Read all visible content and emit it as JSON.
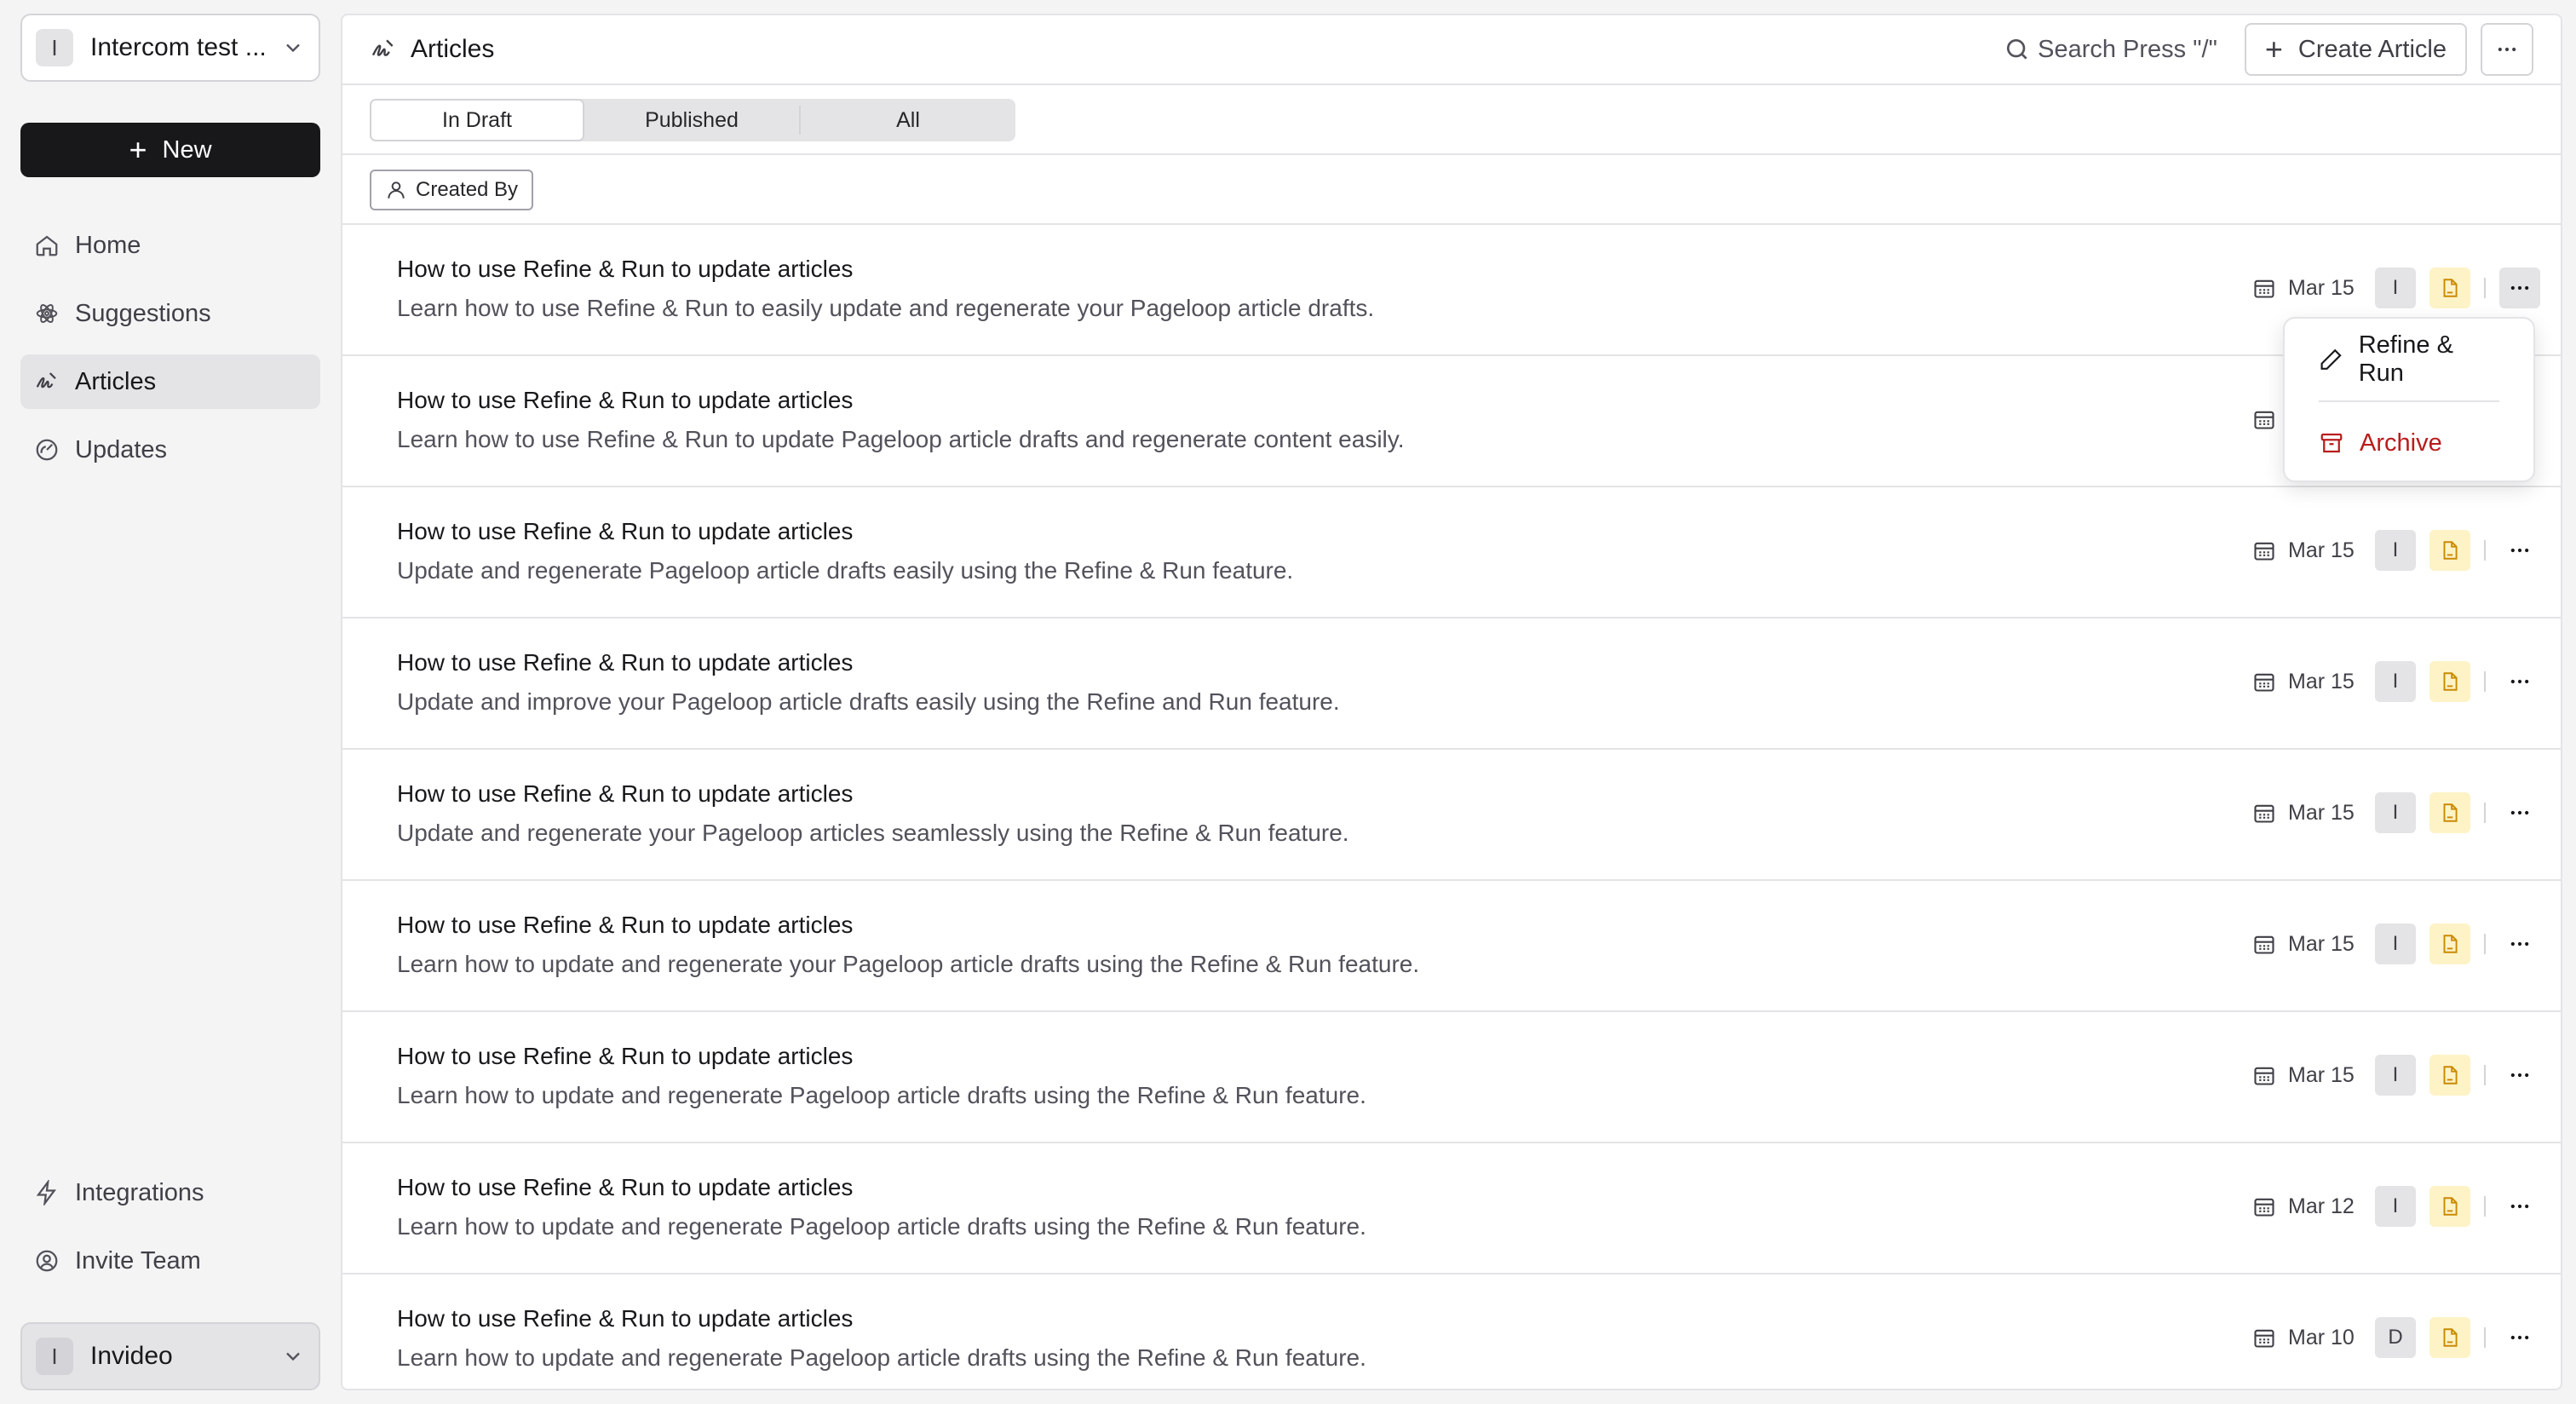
{
  "workspace": {
    "initial": "I",
    "name": "Intercom test ..."
  },
  "sidebar": {
    "new_label": "New",
    "items": [
      {
        "label": "Home",
        "icon": "home-icon"
      },
      {
        "label": "Suggestions",
        "icon": "atom-icon"
      },
      {
        "label": "Articles",
        "icon": "signature-icon",
        "active": true
      },
      {
        "label": "Updates",
        "icon": "gauge-icon"
      }
    ],
    "bottom_items": [
      {
        "label": "Integrations",
        "icon": "bolt-icon"
      },
      {
        "label": "Invite Team",
        "icon": "users-icon"
      }
    ],
    "user": {
      "initial": "I",
      "name": "Invideo"
    }
  },
  "header": {
    "title": "Articles",
    "search_label": "Search Press \"/\"",
    "create_label": "Create Article"
  },
  "tabs": [
    "In Draft",
    "Published",
    "All"
  ],
  "filter_label": "Created By",
  "articles": [
    {
      "title": "How to use Refine & Run to update articles",
      "desc": "Learn how to use Refine & Run to easily update and regenerate your Pageloop article drafts.",
      "date": "Mar 15",
      "author": "I"
    },
    {
      "title": "How to use Refine & Run to update articles",
      "desc": "Learn how to use Refine & Run to update Pageloop article drafts and regenerate content easily.",
      "date": "Mar 15",
      "author": "I"
    },
    {
      "title": "How to use Refine & Run to update articles",
      "desc": "Update and regenerate Pageloop article drafts easily using the Refine & Run feature.",
      "date": "Mar 15",
      "author": "I"
    },
    {
      "title": "How to use Refine & Run to update articles",
      "desc": "Update and improve your Pageloop article drafts easily using the Refine and Run feature.",
      "date": "Mar 15",
      "author": "I"
    },
    {
      "title": "How to use Refine & Run to update articles",
      "desc": "Update and regenerate your Pageloop articles seamlessly using the Refine & Run feature.",
      "date": "Mar 15",
      "author": "I"
    },
    {
      "title": "How to use Refine & Run to update articles",
      "desc": "Learn how to update and regenerate your Pageloop article drafts using the Refine & Run feature.",
      "date": "Mar 15",
      "author": "I"
    },
    {
      "title": "How to use Refine & Run to update articles",
      "desc": "Learn how to update and regenerate Pageloop article drafts using the Refine & Run feature.",
      "date": "Mar 15",
      "author": "I"
    },
    {
      "title": "How to use Refine & Run to update articles",
      "desc": "Learn how to update and regenerate Pageloop article drafts using the Refine & Run feature.",
      "date": "Mar 12",
      "author": "I"
    },
    {
      "title": "How to use Refine & Run to update articles",
      "desc": "Learn how to update and regenerate Pageloop article drafts using the Refine & Run feature.",
      "date": "Mar 10",
      "author": "D"
    }
  ],
  "context_menu": {
    "refine_label": "Refine & Run",
    "archive_label": "Archive"
  },
  "colors": {
    "accent_dark": "#18181b",
    "danger": "#b91c1c",
    "doc_chip": "#fef3c7"
  }
}
